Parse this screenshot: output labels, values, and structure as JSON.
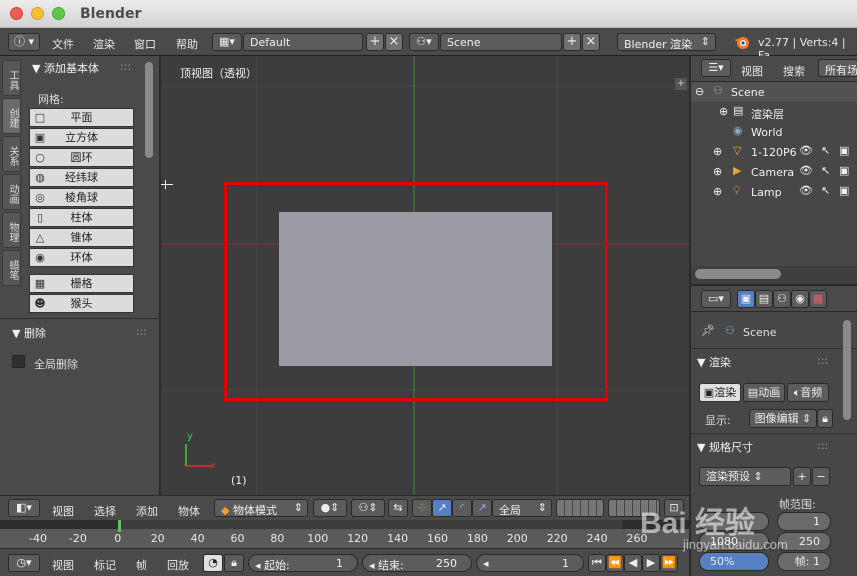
{
  "window": {
    "title": "Blender"
  },
  "topbar": {
    "menus": [
      "文件",
      "渲染",
      "窗口",
      "帮助"
    ],
    "layout": "Default",
    "scene": "Scene",
    "engine": "Blender 渲染",
    "status": "v2.77 | Verts:4 | Fa"
  },
  "tabs": [
    "工具",
    "创建",
    "关系",
    "动画",
    "物理",
    "蜡笔"
  ],
  "add_panel": {
    "title": "添加基本体",
    "mesh_label": "网格:",
    "items": [
      "平面",
      "立方体",
      "圆环",
      "经纬球",
      "棱角球",
      "柱体",
      "锥体",
      "环体",
      "栅格",
      "猴头"
    ]
  },
  "delete_panel": {
    "title": "删除",
    "global_delete": "全局删除"
  },
  "viewport": {
    "label": "顶视图（透视）",
    "frame": "(1)",
    "axis_y": "y"
  },
  "header3d": {
    "menus": [
      "视图",
      "选择",
      "添加",
      "物体"
    ],
    "mode": "物体模式",
    "pivot": "全局"
  },
  "timeline": {
    "ticks": [
      "-40",
      "-20",
      "0",
      "20",
      "40",
      "60",
      "80",
      "100",
      "120",
      "140",
      "160",
      "180",
      "200",
      "220",
      "240",
      "260"
    ],
    "menus": [
      "视图",
      "标记",
      "帧",
      "回放"
    ],
    "start_label": "起始:",
    "start": "1",
    "end_label": "结束:",
    "end": "250",
    "current": "1"
  },
  "outliner": {
    "menus": [
      "视图",
      "搜索"
    ],
    "filter": "所有场",
    "rows": [
      "Scene",
      "渲染层",
      "World",
      "1-120P6",
      "Camera",
      "Lamp"
    ]
  },
  "properties": {
    "scene": "Scene",
    "render_section": "渲染",
    "btn_render": "渲染",
    "btn_anim": "动画",
    "btn_audio": "音频",
    "display_label": "显示:",
    "display_value": "图像编辑",
    "dims_section": "规格尺寸",
    "preset": "渲染预设",
    "frame_range": "帧范围:",
    "res_y": "1080",
    "end_val": "250",
    "percent": "50%",
    "step": "帧: 1",
    "val_1": "1"
  },
  "watermark": {
    "text": "Bai 经验",
    "url": "jingyan.baidu.com"
  },
  "colors": {
    "selection_frame": "#e00000",
    "plane": "#9a9aa3",
    "accent_blue": "#5680c2"
  }
}
